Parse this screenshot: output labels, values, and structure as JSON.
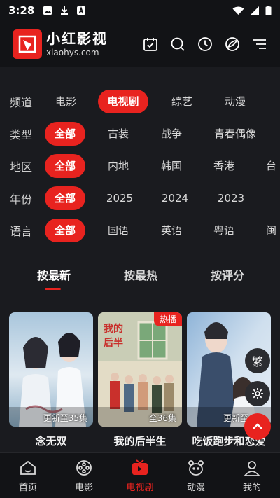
{
  "status_bar": {
    "time": "3:28"
  },
  "app": {
    "name": "小红影视",
    "domain": "xiaohys.com"
  },
  "header_icons": [
    "calendar-check-icon",
    "search-icon",
    "history-clock-icon",
    "skin-theme-icon",
    "menu-icon"
  ],
  "filters": {
    "channel": {
      "label": "频道",
      "options": [
        "电影",
        "电视剧",
        "综艺",
        "动漫"
      ],
      "selected": "电视剧"
    },
    "genre": {
      "label": "类型",
      "options": [
        "全部",
        "古装",
        "战争",
        "青春偶像"
      ],
      "selected": "全部"
    },
    "region": {
      "label": "地区",
      "options": [
        "全部",
        "内地",
        "韩国",
        "香港",
        "台"
      ],
      "selected": "全部"
    },
    "year": {
      "label": "年份",
      "options": [
        "全部",
        "2025",
        "2024",
        "2023"
      ],
      "selected": "全部"
    },
    "language": {
      "label": "语言",
      "options": [
        "全部",
        "国语",
        "英语",
        "粤语",
        "闽"
      ],
      "selected": "全部"
    }
  },
  "sort_tabs": {
    "items": [
      "按最新",
      "按最热",
      "按评分"
    ],
    "selected": "按最新"
  },
  "cards": [
    {
      "title": "念无双",
      "badge": "更新至35集",
      "hot": ""
    },
    {
      "title": "我的后半生",
      "badge": "全36集",
      "hot": "热播"
    },
    {
      "title": "吃饭跑步和恋爱",
      "badge": "更新至",
      "hot": ""
    }
  ],
  "floating": {
    "traditional_label": "繁"
  },
  "bottom_nav": {
    "items": [
      "首页",
      "电影",
      "电视剧",
      "动漫",
      "我的"
    ],
    "selected": "电视剧"
  },
  "colors": {
    "accent": "#e8231f",
    "background": "#1a1b1f",
    "bar": "#121316"
  }
}
